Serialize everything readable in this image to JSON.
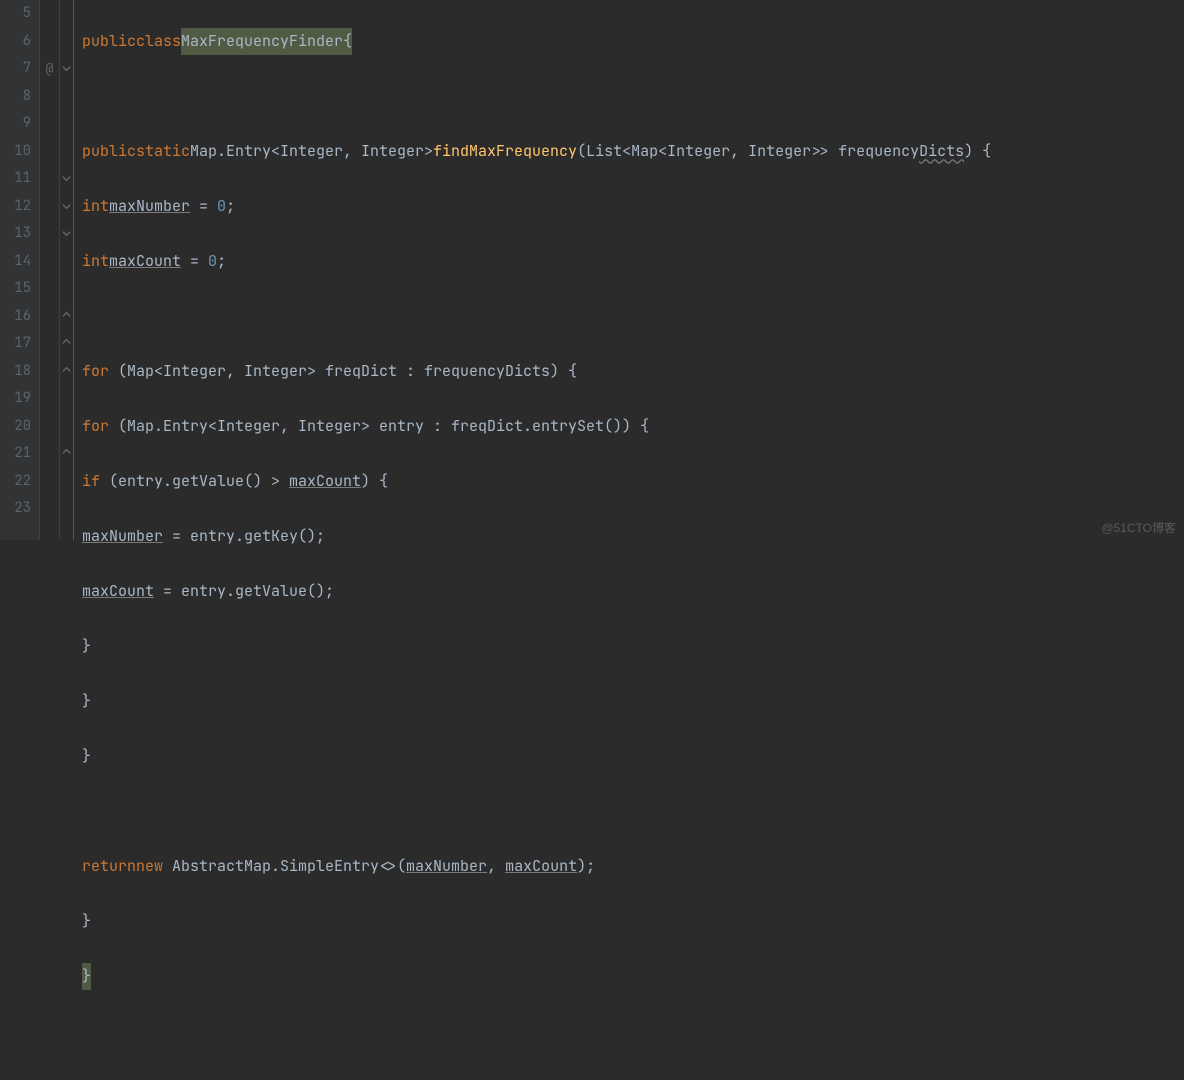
{
  "line_numbers": [
    "5",
    "6",
    "7",
    "8",
    "9",
    "10",
    "11",
    "12",
    "13",
    "14",
    "15",
    "16",
    "17",
    "18",
    "19",
    "20",
    "21",
    "22",
    "23"
  ],
  "annotation_line7": "@",
  "watermark": "@51CTO博客",
  "code": {
    "l5_public": "public",
    "l5_class": "class",
    "l5_name": "MaxFrequencyFinder",
    "l5_brace": "{",
    "l7_public": "public",
    "l7_static": "static",
    "l7_type1": "Map.Entry<Integer, Integer>",
    "l7_fn": "findMaxFrequency",
    "l7_p1": "(List<Map<Integer, Integer>> ",
    "l7_p2": "frequency",
    "l7_p3": "Dicts",
    "l7_p4": ") {",
    "l8_int": "int",
    "l8_var": "maxNumber",
    "l8_eq": " = ",
    "l8_zero": "0",
    "l8_semi": ";",
    "l9_int": "int",
    "l9_var": "maxCount",
    "l9_eq": " = ",
    "l9_zero": "0",
    "l9_semi": ";",
    "l11_for": "for",
    "l11_rest": " (Map<Integer, Integer> freqDict : frequencyDicts) {",
    "l12_for": "for",
    "l12_rest": " (Map.Entry<Integer, Integer> entry : freqDict.entrySet()) {",
    "l13_if": "if",
    "l13_a": " (entry.getValue() > ",
    "l13_b": "maxCount",
    "l13_c": ") {",
    "l14_a": "maxNumber",
    "l14_b": " = entry.getKey();",
    "l15_a": "maxCount",
    "l15_b": " = entry.getValue();",
    "l16": "}",
    "l17": "}",
    "l18": "}",
    "l20_return": "return",
    "l20_new": "new",
    "l20_a": " AbstractMap.SimpleEntry<>(",
    "l20_b": "maxNumber",
    "l20_c": ", ",
    "l20_d": "maxCount",
    "l20_e": ");",
    "l21": "}",
    "l22": "}"
  }
}
